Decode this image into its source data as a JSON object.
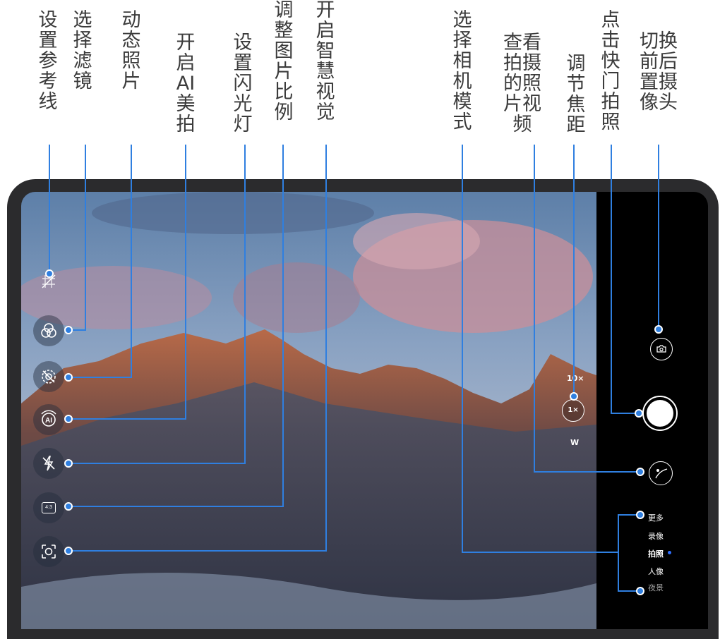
{
  "annotations": {
    "reference_lines": "设置参考线",
    "filter": "选择滤镜",
    "moving_picture": "动态照片",
    "ai_beauty": "开启AI美拍",
    "flash": "设置闪光灯",
    "aspect_ratio": "调整图片比例",
    "ai_lens": "开启智慧视觉",
    "camera_mode": "选择相机模式",
    "gallery": "查看拍摄的照片视频",
    "zoom": "调节焦距",
    "shutter": "点击快门拍照",
    "switch_camera": "切换前后置摄像头"
  },
  "camera": {
    "aspect_ratio_label": "4:3",
    "zoom": {
      "tele": "10×",
      "current": "1×",
      "wide": "W"
    },
    "modes": [
      "更多",
      "录像",
      "拍照",
      "人像",
      "夜景"
    ],
    "active_mode": "拍照"
  },
  "colors": {
    "accent": "#2f7fe0",
    "mode_dot": "#2f6fff"
  }
}
